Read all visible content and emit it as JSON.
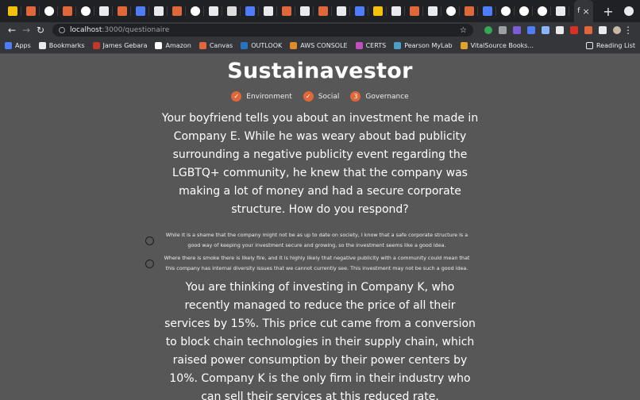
{
  "browser": {
    "tabs": [
      {
        "icon": "tab-favicon",
        "color": "#f4c20d"
      },
      {
        "icon": "tab-favicon",
        "color": "#e0673a"
      },
      {
        "icon": "google-icon",
        "color": "#ffffff"
      },
      {
        "icon": "tab-favicon",
        "color": "#e0673a"
      },
      {
        "icon": "google-icon",
        "color": "#ffffff"
      },
      {
        "icon": "tab-favicon",
        "color": "#e8eaed"
      },
      {
        "icon": "tab-favicon",
        "color": "#e0673a"
      },
      {
        "icon": "tab-favicon",
        "color": "#4f7df9"
      },
      {
        "icon": "tab-favicon",
        "color": "#e8eaed"
      },
      {
        "icon": "tab-favicon",
        "color": "#e0673a"
      },
      {
        "icon": "google-icon",
        "color": "#ffffff"
      },
      {
        "icon": "tab-favicon",
        "color": "#e8eaed"
      },
      {
        "icon": "tab-favicon",
        "color": "#dddddd"
      },
      {
        "icon": "tab-favicon",
        "color": "#4f7df9"
      },
      {
        "icon": "tab-favicon",
        "color": "#e8eaed"
      },
      {
        "icon": "tab-favicon",
        "color": "#e0673a"
      },
      {
        "icon": "tab-favicon",
        "color": "#e8eaed"
      },
      {
        "icon": "tab-favicon",
        "color": "#e0673a"
      },
      {
        "icon": "tab-favicon",
        "color": "#e8eaed"
      },
      {
        "icon": "tab-favicon",
        "color": "#4f7df9"
      },
      {
        "icon": "tab-favicon",
        "color": "#f4c20d"
      },
      {
        "icon": "tab-favicon",
        "color": "#e8eaed"
      },
      {
        "icon": "tab-favicon",
        "color": "#e0673a"
      },
      {
        "icon": "tab-favicon",
        "color": "#e8eaed"
      },
      {
        "icon": "github-icon",
        "color": "#ffffff"
      },
      {
        "icon": "tab-favicon",
        "color": "#e0673a"
      },
      {
        "icon": "tab-favicon",
        "color": "#4f7df9"
      },
      {
        "icon": "github-icon",
        "color": "#ffffff"
      },
      {
        "icon": "github-icon",
        "color": "#ffffff"
      },
      {
        "icon": "github-icon",
        "color": "#ffffff"
      },
      {
        "icon": "tab-favicon",
        "color": "#e8eaed"
      }
    ],
    "active_tab_label": "f",
    "new_tab_label": "+",
    "url_host": "localhost",
    "url_path": ":3000/questionaire",
    "bookmarks": [
      {
        "label": "Apps",
        "color": "#4f7df9"
      },
      {
        "label": "Bookmarks",
        "color": "#e8eaed"
      },
      {
        "label": "James Gebara",
        "color": "#c0392b"
      },
      {
        "label": "Amazon",
        "color": "#ffffff"
      },
      {
        "label": "Canvas",
        "color": "#e0673a"
      },
      {
        "label": "OUTLOOK",
        "color": "#2a72c4"
      },
      {
        "label": "AWS CONSOLE",
        "color": "#e08a2a"
      },
      {
        "label": "CERTS",
        "color": "#c04fc0"
      },
      {
        "label": "Pearson MyLab",
        "color": "#4aa0c8"
      },
      {
        "label": "VitalSource Books...",
        "color": "#e0a22a"
      }
    ],
    "reading_list_label": "Reading List"
  },
  "page": {
    "title": "Sustainavestor",
    "steps": [
      {
        "label": "Environment",
        "marker": "✓",
        "state": "done"
      },
      {
        "label": "Social",
        "marker": "✓",
        "state": "done"
      },
      {
        "label": "Governance",
        "marker": "3",
        "state": "current"
      }
    ],
    "question1": "Your boyfriend tells you about an investment he made in Company E. While he was weary about bad publicity surrounding a negative publicity event regarding the LGBTQ+ community, he knew that the company was making a lot of money and had a secure corporate structure. How do you respond?",
    "question1_options": [
      "While it is a shame that the company might not be as up to date on society, I know that a safe corporate structure is a good way of keeping your investment secure and growing, so the investment seems like a good idea.",
      "Where there is smoke there is likely fire, and it is highly likely that negative publicity with a community could mean that this company has internal diversity issues that we cannot currently see. This investment may not be such a good idea."
    ],
    "question2": "You are thinking of investing in Company K, who recently managed to reduce the price of all their services by 15%. This price cut came from a conversion to block chain technologies in their supply chain, which raised power consumption by their power centers by 10%. Company K is the only firm in their industry who can sell their services at this reduced rate."
  },
  "colors": {
    "page_bg": "#575757",
    "accent": "#e0673a",
    "text": "#ffffff"
  }
}
